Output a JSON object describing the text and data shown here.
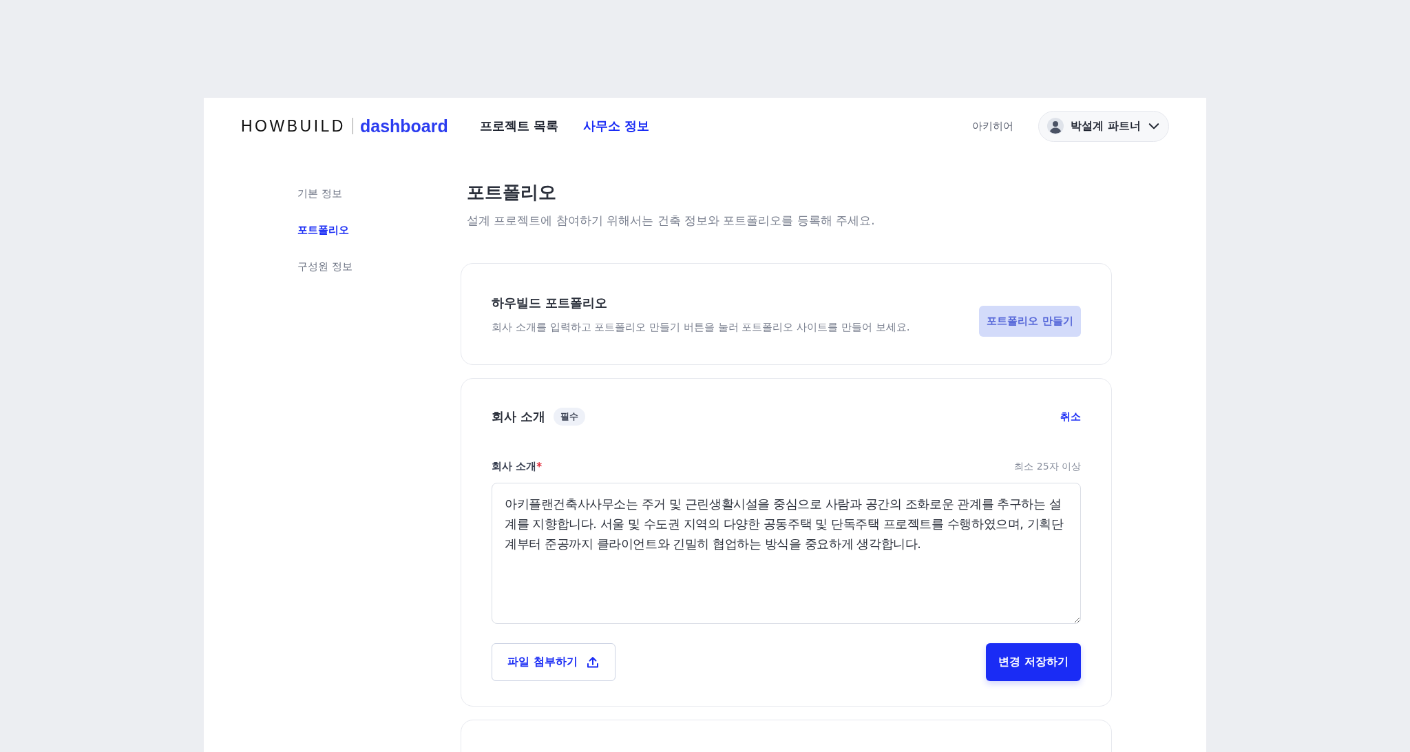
{
  "header": {
    "logo_main": "HOWBUILD",
    "logo_sub": "dashboard",
    "nav": [
      {
        "label": "프로젝트 목록",
        "selected": false
      },
      {
        "label": "사무소 정보",
        "selected": true
      }
    ],
    "office_name": "아키히어",
    "user": {
      "name": "박설계 파트너"
    }
  },
  "sidebar": {
    "items": [
      {
        "label": "기본 정보",
        "selected": false
      },
      {
        "label": "포트폴리오",
        "selected": true
      },
      {
        "label": "구성원 정보",
        "selected": false
      }
    ]
  },
  "page": {
    "title": "포트폴리오",
    "subtitle": "설계 프로젝트에 참여하기 위해서는 건축 정보와 포트폴리오를 등록해 주세요."
  },
  "portfolio_card": {
    "title": "하우빌드 포트폴리오",
    "description": "회사 소개를 입력하고 포트폴리오 만들기 버튼을 눌러 포트폴리오 사이트를 만들어 보세요.",
    "button": {
      "label": "포트폴리오 만들기",
      "disabled": true
    }
  },
  "intro_card": {
    "title": "회사 소개",
    "badge": "필수",
    "cancel": "취소",
    "field": {
      "label": "회사 소개",
      "required_mark": "*",
      "hint": "최소 25자 이상",
      "value": "아키플랜건축사사무소는 주거 및 근린생활시설을 중심으로 사람과 공간의 조화로운 관계를 추구하는 설계를 지향합니다. 서울 및 수도권 지역의 다양한 공동주택 및 단독주택 프로젝트를 수행하였으며, 기획단계부터 준공까지 클라이언트와 긴밀히 협업하는 방식을 중요하게 생각합니다."
    },
    "attach_button": "파일 첨부하기",
    "save_button": "변경 저장하기"
  }
}
